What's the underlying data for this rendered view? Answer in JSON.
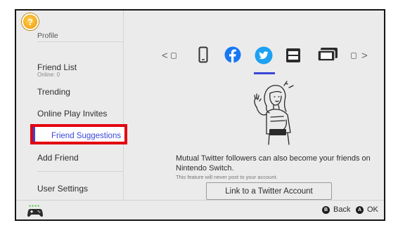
{
  "sidebar": {
    "profile": "Profile",
    "friend_list": "Friend List",
    "online_count": "Online: 0",
    "trending": "Trending",
    "online_play_invites": "Online Play Invites",
    "friend_suggestions": "Friend Suggestions",
    "add_friend": "Add Friend",
    "user_settings": "User Settings"
  },
  "content": {
    "message": "Mutual Twitter followers can also become your friends on Nintendo Switch.",
    "note": "This feature will never post to your account.",
    "link_button": "Link to a Twitter Account",
    "selected_source": "twitter",
    "sources": [
      "phone-icon",
      "facebook-icon",
      "twitter-icon",
      "nintendo-switch-icon",
      "play-history-icon"
    ]
  },
  "footer": {
    "back_label": "Back",
    "ok_label": "OK",
    "back_button": "B",
    "ok_button": "A"
  },
  "colors": {
    "accent": "#3a46d8",
    "highlight_box": "#e30010",
    "facebook": "#1877f2",
    "twitter": "#1da1f2"
  }
}
